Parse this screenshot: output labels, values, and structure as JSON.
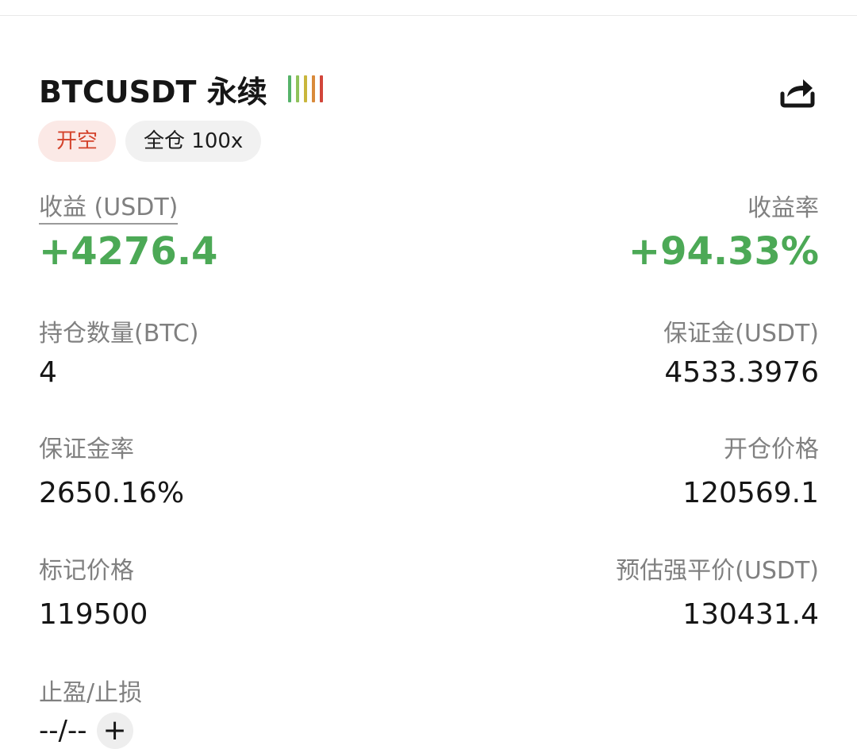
{
  "position": {
    "symbol": "BTCUSDT 永续",
    "signal_bar_colors": [
      "#56b36a",
      "#8fc25a",
      "#c9b63c",
      "#d98a3a",
      "#d2463a"
    ],
    "direction_tag": "开空",
    "margin_mode_tag": "全仓 100x",
    "share_icon": "share-arrow-icon"
  },
  "pnl": {
    "label": "收益 (USDT)",
    "value": "+4276.4"
  },
  "roe": {
    "label": "收益率",
    "value": "+94.33%"
  },
  "size": {
    "label": "持仓数量(BTC)",
    "value": "4"
  },
  "margin": {
    "label": "保证金(USDT)",
    "value": "4533.3976"
  },
  "margin_ratio": {
    "label": "保证金率",
    "value": "2650.16%"
  },
  "entry_price": {
    "label": "开仓价格",
    "value": "120569.1"
  },
  "mark_price": {
    "label": "标记价格",
    "value": "119500"
  },
  "liq_price": {
    "label": "预估强平价(USDT)",
    "value": "130431.4"
  },
  "tpsl": {
    "label": "止盈/止损",
    "value": "--/--",
    "add_symbol": "+"
  },
  "colors": {
    "profit_green": "#4ca956",
    "short_red": "#d4432c",
    "short_tag_bg": "#fbe9e6"
  }
}
